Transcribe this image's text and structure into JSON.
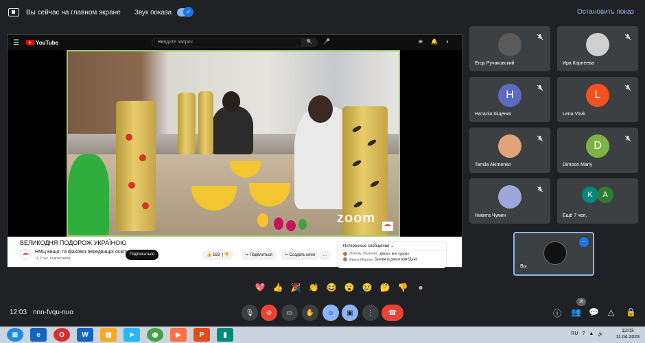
{
  "presentation_bar": {
    "title": "Вы сейчас на главном экране",
    "sound_label": "Звук показа",
    "sound_on": true,
    "stop_label": "Остановить показ"
  },
  "youtube": {
    "search_placeholder": "Введите запрос",
    "logo_text": "YouTube",
    "notification_count": "1",
    "video": {
      "title": "ВЕЛИКОДНЯ ПОДОРОЖ УКРАЇНОЮ",
      "watermark": "zoom",
      "channel": "НМЦ вищої та фахової передвищої освіти",
      "subscribers": "11,2 тыс. подписчиков",
      "subscribe_label": "Подписаться",
      "likes": "163",
      "share_label": "Поделиться",
      "clip_label": "Создать клип",
      "more_label": "..."
    },
    "live_chat": {
      "header": "Интересные сообщения",
      "messages": [
        {
          "author": "Любовь Ульянова",
          "text": "Дякую, все чудово"
        },
        {
          "author": "Ирина Мирная",
          "text": "Буковина дякую вам!!Дуже"
        }
      ]
    }
  },
  "participants": [
    {
      "name": "Егор Ручаковский",
      "initial": "",
      "color": "#5a5a5a",
      "muted": true
    },
    {
      "name": "Ира Корнеева",
      "initial": "",
      "color": "#cfcfcf",
      "muted": true
    },
    {
      "name": "Наталія Кіщенко",
      "initial": "H",
      "color": "#5c6bc0",
      "muted": true
    },
    {
      "name": "Lena Vovk",
      "initial": "L",
      "color": "#f4511e",
      "muted": true
    },
    {
      "name": "Tamila Akimenko",
      "initial": "",
      "color": "#e0a37a",
      "muted": true
    },
    {
      "name": "Dimoon Mariy",
      "initial": "D",
      "color": "#7cb342",
      "muted": true
    },
    {
      "name": "Никита Чумин",
      "initial": "",
      "color": "#9fa8da",
      "muted": true
    },
    {
      "name": "Ещё 7 чел.",
      "initial": "K",
      "initial2": "A",
      "color": "#00897b",
      "muted": false
    }
  ],
  "self_tile": {
    "name": "Вы"
  },
  "reactions": [
    "💖",
    "👍",
    "🎉",
    "👏",
    "😂",
    "😮",
    "😢",
    "🤔",
    "👎"
  ],
  "bottom_bar": {
    "time": "12:03",
    "meeting_code": "nnn-fvqu-nuo",
    "participant_count": "16"
  },
  "taskbar": {
    "lang": "RU",
    "time": "12:03",
    "date": "11.04.2023"
  }
}
